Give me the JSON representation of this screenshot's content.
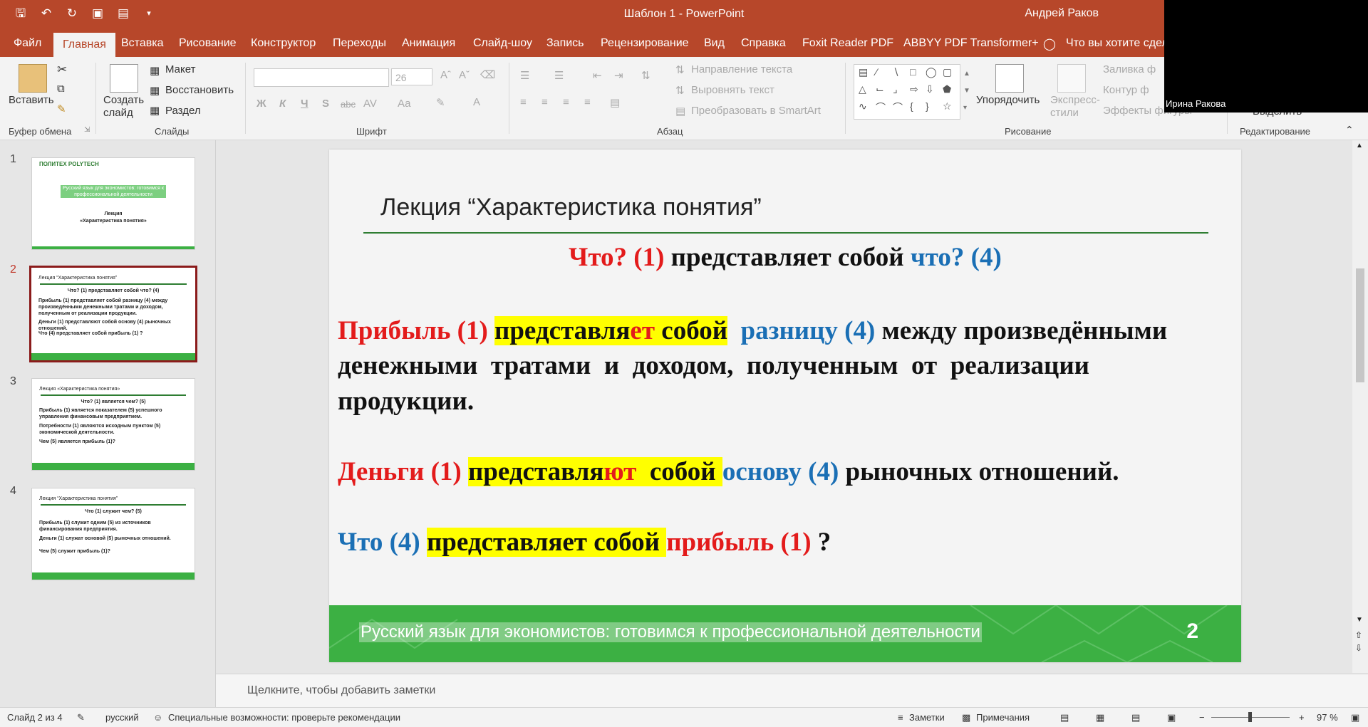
{
  "window": {
    "title": "Шаблон 1  -  PowerPoint",
    "user": "Андрей Раков"
  },
  "qat_icons": [
    "save-icon",
    "undo-icon",
    "redo-icon",
    "present-icon",
    "autosave-icon",
    "customize-icon"
  ],
  "menu": {
    "items": [
      "Файл",
      "Главная",
      "Вставка",
      "Рисование",
      "Конструктор",
      "Переходы",
      "Анимация",
      "Слайд-шоу",
      "Запись",
      "Рецензирование",
      "Вид",
      "Справка",
      "Foxit Reader PDF",
      "ABBYY PDF Transformer+"
    ],
    "active": "Главная",
    "tell_me": "Что вы хотите сдела"
  },
  "ribbon": {
    "clipboard": {
      "paste": "Вставить",
      "label": "Буфер обмена"
    },
    "slides": {
      "new_slide": "Создать слайд",
      "layout": "Макет",
      "reset": "Восстановить",
      "section": "Раздел",
      "label": "Слайды"
    },
    "font": {
      "size": "26",
      "label": "Шрифт",
      "bold": "Ж",
      "italic": "К",
      "underline": "Ч",
      "shadow": "S",
      "strike": "abc",
      "spacing": "AV",
      "case": "Аа"
    },
    "paragraph": {
      "text_direction": "Направление текста",
      "align_text": "Выровнять текст",
      "smartart": "Преобразовать в SmartArt",
      "label": "Абзац"
    },
    "drawing": {
      "arrange": "Упорядочить",
      "quick_styles": "Экспресс-стили",
      "fill": "Заливка ф",
      "outline": "Контур ф",
      "effects": "Эффекты фигуры",
      "label": "Рисование"
    },
    "editing": {
      "select": "Выделить",
      "label": "Редактирование"
    }
  },
  "video": {
    "name": "Ирина Ракова"
  },
  "thumbnails": [
    {
      "num": "1",
      "lines": [
        "ПОЛИТЕХ   POLYTECH",
        "Русский язык для экономистов: готовимся к профессиональной деятельности",
        "Лекция",
        "«Характеристика понятия»"
      ]
    },
    {
      "num": "2",
      "lines": [
        "Лекция  “Характеристика понятия”",
        "Что? (1) представляет собой что? (4)",
        "Прибыль (1) представляет собой разницу (4) между произведёнными денежными тратами и доходом, полученным от реализации продукции.",
        "Деньги (1) представляют собой основу (4) рыночных отношений.",
        "Что (4) представляет собой прибыль (1) ?"
      ]
    },
    {
      "num": "3",
      "lines": [
        "Лекция «Характеристика понятия»",
        "Что? (1) является чем? (5)",
        "Прибыль (1) является показателем (5) успешного управления финансовым предприятием.",
        "Потребности (1) являются исходным пунктом (5) экономической деятельности.",
        "Чем (5) является прибыль (1)?"
      ]
    },
    {
      "num": "4",
      "lines": [
        "Лекция “Характеристика понятия”",
        "Что (1) служит чем? (5)",
        "Прибыль (1) служит одним (5) из источников финансирования предприятия.",
        "Деньги (1) служат основой (5) рыночных отношений.",
        "Чем (5) служит прибыль (1)?"
      ]
    }
  ],
  "slide": {
    "title": "Лекция  “Характеристика понятия”",
    "pattern": {
      "what1": "Что? (1)",
      "predicate": " представляет собой ",
      "what4": "что? (4)"
    },
    "s1": {
      "subj": "Прибыль (1) ",
      "pred_a": "представля",
      "pred_b": "ет",
      "pred_c": " собой",
      "obj": "разницу (4)",
      "rest1": " между произведёнными",
      "line2": "денежными  тратами  и  доходом,  полученным  от  реализации",
      "line3": "продукции."
    },
    "s2": {
      "subj": "Деньги (1) ",
      "pred_a": "представля",
      "pred_b": "ют",
      "pred_c": "  собой ",
      "obj": "основу (4)",
      "rest": " рыночных отношений."
    },
    "s3": {
      "subj": "Что (4) ",
      "pred": "представляет собой ",
      "obj": "прибыль (1)",
      "rest": " ?"
    },
    "footer": "Русский  язык для экономистов: готовимся к профессиональной деятельности",
    "number": "2"
  },
  "notes": {
    "placeholder": "Щелкните, чтобы добавить заметки"
  },
  "status": {
    "slide": "Слайд 2 из 4",
    "lang": "русский",
    "accessibility": "Специальные возможности: проверьте рекомендации",
    "notes": "Заметки",
    "comments": "Примечания",
    "zoom": "97 %"
  }
}
